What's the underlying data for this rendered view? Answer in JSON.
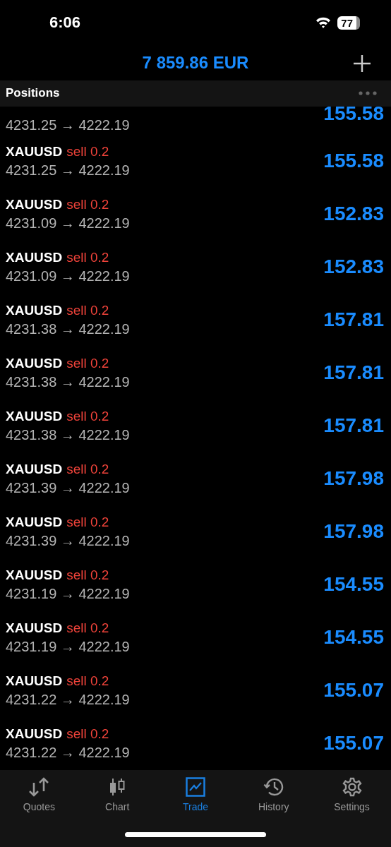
{
  "status_bar": {
    "time": "6:06",
    "battery": "77"
  },
  "header": {
    "balance": "7 859.86 EUR"
  },
  "section": {
    "title": "Positions"
  },
  "positions": [
    {
      "kind": "partial",
      "prices": "4231.25 → 4222.19",
      "profit": "155.58"
    },
    {
      "kind": "full",
      "symbol": "XAUUSD",
      "side": "sell 0.2",
      "prices": "4231.25 → 4222.19",
      "profit": "155.58"
    },
    {
      "kind": "full",
      "symbol": "XAUUSD",
      "side": "sell 0.2",
      "prices": "4231.09 → 4222.19",
      "profit": "152.83"
    },
    {
      "kind": "full",
      "symbol": "XAUUSD",
      "side": "sell 0.2",
      "prices": "4231.09 → 4222.19",
      "profit": "152.83"
    },
    {
      "kind": "full",
      "symbol": "XAUUSD",
      "side": "sell 0.2",
      "prices": "4231.38 → 4222.19",
      "profit": "157.81"
    },
    {
      "kind": "full",
      "symbol": "XAUUSD",
      "side": "sell 0.2",
      "prices": "4231.38 → 4222.19",
      "profit": "157.81"
    },
    {
      "kind": "full",
      "symbol": "XAUUSD",
      "side": "sell 0.2",
      "prices": "4231.38 → 4222.19",
      "profit": "157.81"
    },
    {
      "kind": "full",
      "symbol": "XAUUSD",
      "side": "sell 0.2",
      "prices": "4231.39 → 4222.19",
      "profit": "157.98"
    },
    {
      "kind": "full",
      "symbol": "XAUUSD",
      "side": "sell 0.2",
      "prices": "4231.39 → 4222.19",
      "profit": "157.98"
    },
    {
      "kind": "full",
      "symbol": "XAUUSD",
      "side": "sell 0.2",
      "prices": "4231.19 → 4222.19",
      "profit": "154.55"
    },
    {
      "kind": "full",
      "symbol": "XAUUSD",
      "side": "sell 0.2",
      "prices": "4231.19 → 4222.19",
      "profit": "154.55"
    },
    {
      "kind": "full",
      "symbol": "XAUUSD",
      "side": "sell 0.2",
      "prices": "4231.22 → 4222.19",
      "profit": "155.07"
    },
    {
      "kind": "full",
      "symbol": "XAUUSD",
      "side": "sell 0.2",
      "prices": "4231.22 → 4222.19",
      "profit": "155.07"
    }
  ],
  "tabs": [
    {
      "label": "Quotes",
      "selected": false
    },
    {
      "label": "Chart",
      "selected": false
    },
    {
      "label": "Trade",
      "selected": true
    },
    {
      "label": "History",
      "selected": false
    },
    {
      "label": "Settings",
      "selected": false
    }
  ]
}
